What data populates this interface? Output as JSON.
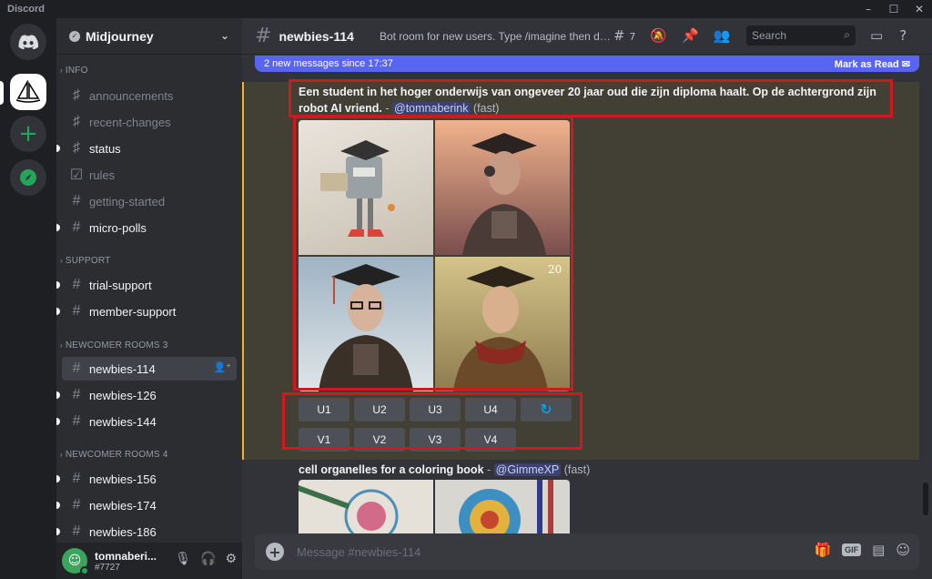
{
  "window": {
    "title": "Discord",
    "controls": [
      "–",
      "☐",
      "✕"
    ]
  },
  "rail": {
    "icons": [
      "discord-home-icon",
      "midjourney-server-icon",
      "add-server-icon",
      "explore-icon"
    ]
  },
  "guild": {
    "name": "Midjourney"
  },
  "categories": {
    "info": "INFO",
    "support": "SUPPORT",
    "newcomer3": "NEWCOMER ROOMS 3",
    "newcomer4": "NEWCOMER ROOMS 4"
  },
  "channels": {
    "announcements": "announcements",
    "recent_changes": "recent-changes",
    "status": "status",
    "rules": "rules",
    "getting_started": "getting-started",
    "micro_polls": "micro-polls",
    "trial_support": "trial-support",
    "member_support": "member-support",
    "newbies_114": "newbies-114",
    "newbies_126": "newbies-126",
    "newbies_144": "newbies-144",
    "newbies_156": "newbies-156",
    "newbies_174": "newbies-174",
    "newbies_186": "newbies-186"
  },
  "user": {
    "name": "tomnaberi...",
    "tag": "#7727"
  },
  "header": {
    "channel": "newbies-114",
    "topic": "Bot room for new users. Type /imagine then des...",
    "threads_count": "7",
    "search_placeholder": "Search"
  },
  "banner": {
    "text": "2 new messages since 17:37",
    "action": "Mark as Read"
  },
  "message1": {
    "prompt": "Een student in het hoger onderwijs van ongeveer 20 jaar oud die zijn diploma haalt. Op de achtergrond zijn robot AI vriend.",
    "separator": " - ",
    "mention": "@tomnaberink",
    "speed": "(fast)",
    "buttons_upscale": [
      "U1",
      "U2",
      "U3",
      "U4"
    ],
    "buttons_variation": [
      "V1",
      "V2",
      "V3",
      "V4"
    ],
    "refresh_icon": "↻"
  },
  "message2": {
    "prompt": "cell organelles for a coloring book",
    "separator": " - ",
    "mention": "@GimmeXP",
    "speed": "(fast)"
  },
  "composer": {
    "placeholder": "Message #newbies-114"
  },
  "colors": {
    "accent": "#5865f2",
    "highlight_bar": "#f0b232",
    "annotation_red": "#d0191f"
  }
}
